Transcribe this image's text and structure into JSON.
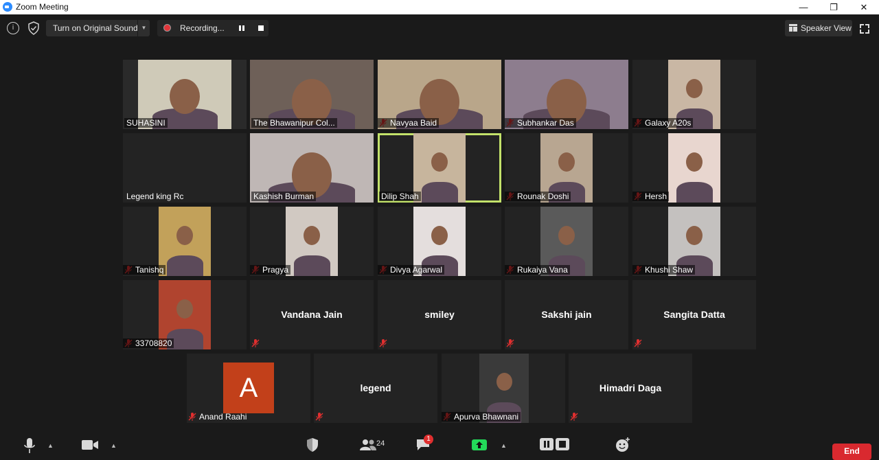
{
  "window": {
    "title": "Zoom Meeting",
    "minimize": "—",
    "restore": "❐",
    "close": "✕"
  },
  "toolbar": {
    "info_glyph": "i",
    "original_sound_label": "Turn on Original Sound",
    "dropdown_glyph": "▼",
    "recording_label": "Recording...",
    "speaker_view_label": "Speaker View"
  },
  "tiles": [
    {
      "name": "SUHASINI",
      "muted": false,
      "video": true,
      "bg": "#2a2a2a",
      "scene": "#cfcab8"
    },
    {
      "name": "The Bhawanipur Col...",
      "muted": false,
      "video": true,
      "bg": "#5a4a42",
      "scene": "#6e6058"
    },
    {
      "name": "Navyaa Baid",
      "muted": true,
      "video": true,
      "bg": "#8c7a63",
      "scene": "#b9a68a"
    },
    {
      "name": "Subhankar Das",
      "muted": true,
      "video": true,
      "bg": "#7b6a78",
      "scene": "#8d7d8e"
    },
    {
      "name": "Galaxy A20s",
      "muted": true,
      "video": true,
      "bg": "#232323",
      "scene": "#c9b7a4"
    },
    {
      "name": "Legend king Rc",
      "muted": false,
      "video": false,
      "bg": "#232323",
      "scene": ""
    },
    {
      "name": "Kashish Burman",
      "muted": false,
      "video": true,
      "bg": "#2f2b2b",
      "scene": "#bfb7b5"
    },
    {
      "name": "Dilip Shah",
      "muted": false,
      "video": true,
      "bg": "#232323",
      "scene": "#c7b59d",
      "active": true
    },
    {
      "name": "Rounak Doshi",
      "muted": true,
      "video": true,
      "bg": "#232323",
      "scene": "#b8a691"
    },
    {
      "name": "Hersh",
      "muted": true,
      "video": true,
      "bg": "#232323",
      "scene": "#e8d6cf"
    },
    {
      "name": "Tanishq",
      "muted": true,
      "video": true,
      "bg": "#232323",
      "scene": "#c2a15a"
    },
    {
      "name": "Pragya",
      "muted": true,
      "video": true,
      "bg": "#232323",
      "scene": "#d1c9c2"
    },
    {
      "name": "Divya Agarwal",
      "muted": true,
      "video": true,
      "bg": "#232323",
      "scene": "#e4dedd"
    },
    {
      "name": "Rukaiya Vana",
      "muted": true,
      "video": true,
      "bg": "#232323",
      "scene": "#5a5a5a"
    },
    {
      "name": "Khushi Shaw",
      "muted": true,
      "video": true,
      "bg": "#232323",
      "scene": "#c4c1bf"
    },
    {
      "name": "33708820",
      "muted": true,
      "video": true,
      "bg": "#232323",
      "scene": "#b0442f"
    },
    {
      "name": "Vandana Jain",
      "muted": true,
      "video": false,
      "bg": "#232323",
      "scene": ""
    },
    {
      "name": "smiley",
      "muted": true,
      "video": false,
      "bg": "#232323",
      "scene": ""
    },
    {
      "name": "Sakshi jain",
      "muted": true,
      "video": false,
      "bg": "#232323",
      "scene": ""
    },
    {
      "name": "Sangita Datta",
      "muted": true,
      "video": false,
      "bg": "#232323",
      "scene": ""
    },
    {
      "name": "Anand Raahi",
      "muted": true,
      "video": false,
      "avatar_letter": "A",
      "avatar_color": "#c2401a",
      "bg": "#232323",
      "scene": ""
    },
    {
      "name": "legend",
      "muted": true,
      "video": false,
      "bg": "#232323",
      "scene": ""
    },
    {
      "name": "Apurva Bhawnani",
      "muted": true,
      "video": true,
      "bg": "#232323",
      "scene": "#3a3a3a"
    },
    {
      "name": "Himadri Daga",
      "muted": true,
      "video": false,
      "bg": "#232323",
      "scene": ""
    }
  ],
  "bottombar": {
    "participants_count": "24",
    "chat_badge": "1",
    "end_label": "End",
    "chevron_glyph": "▲"
  },
  "colors": {
    "mute_red": "#e02f2f",
    "active_border": "#c3e26a",
    "share_green": "#23d959",
    "end_red": "#d9292f"
  }
}
